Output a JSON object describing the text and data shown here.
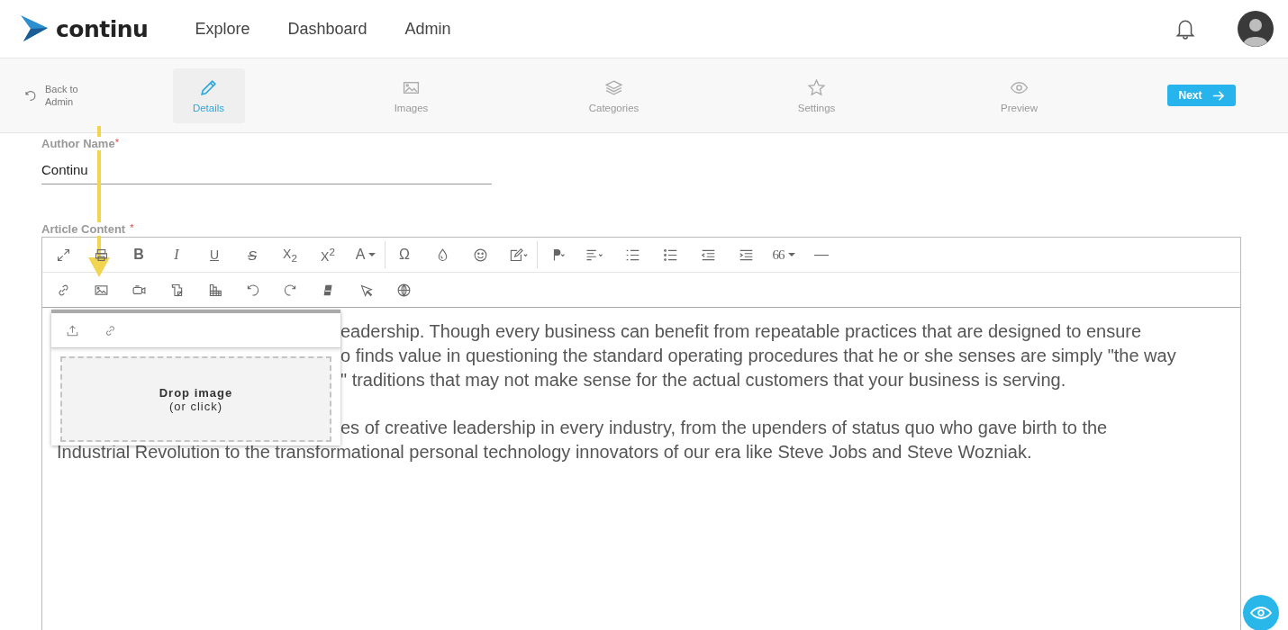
{
  "header": {
    "logo": "continu",
    "nav": [
      {
        "label": "Explore"
      },
      {
        "label": "Dashboard"
      },
      {
        "label": "Admin"
      }
    ]
  },
  "step_bar": {
    "back": "Back to Admin",
    "steps": [
      {
        "label": "Details",
        "kind": "pencil",
        "selected": true
      },
      {
        "label": "Images",
        "kind": "image",
        "selected": false
      },
      {
        "label": "Categories",
        "kind": "layers",
        "selected": false
      },
      {
        "label": "Settings",
        "kind": "star",
        "selected": false
      },
      {
        "label": "Preview",
        "kind": "eye",
        "selected": false
      }
    ],
    "next": "Next"
  },
  "author_field": {
    "label": "Author Name",
    "required_mark": "*",
    "value": "Continu"
  },
  "content_field": {
    "label": "Article Content",
    "required_mark": "*"
  },
  "toolbar": {
    "rows": [
      [
        {
          "kind": "expand"
        },
        {
          "kind": "print"
        },
        {
          "kind": "bold",
          "label": "B"
        },
        {
          "kind": "italic",
          "label": "I"
        },
        {
          "kind": "underline",
          "label": "U"
        },
        {
          "kind": "strike",
          "label": "S"
        },
        {
          "kind": "script",
          "label": "X$_{2}$"
        },
        {
          "kind": "script",
          "label": "X$^{2}$"
        },
        {
          "kind": "fontcolor",
          "label": "A"
        },
        {
          "kind": "sep"
        },
        {
          "kind": "plain",
          "label": "Ω"
        },
        {
          "kind": "drop"
        },
        {
          "kind": "smile"
        },
        {
          "kind": "edit"
        },
        {
          "kind": "sep"
        },
        {
          "kind": "paragraph"
        },
        {
          "kind": "align"
        },
        {
          "kind": "ol"
        },
        {
          "kind": "ul"
        },
        {
          "kind": "outdent"
        },
        {
          "kind": "indent"
        },
        {
          "kind": "quote",
          "label": "66"
        },
        {
          "kind": "plain",
          "label": "—"
        }
      ],
      [
        {
          "kind": "link"
        },
        {
          "kind": "image"
        },
        {
          "kind": "video"
        },
        {
          "kind": "file"
        },
        {
          "kind": "table"
        },
        {
          "kind": "undo"
        },
        {
          "kind": "redo"
        },
        {
          "kind": "eraser"
        },
        {
          "kind": "cursor"
        },
        {
          "kind": "globe"
        }
      ]
    ]
  },
  "image_popup": {
    "tabs": [
      {
        "kind": "upload"
      },
      {
        "kind": "link"
      }
    ],
    "drop_title": "Drop image",
    "drop_hint": "(or click)"
  },
  "paragraphs": [
    {
      "lines": [
        {
          "text": "eadership. Though every business can benefit from repeatable practices that are designed to ensure",
          "covered": true
        },
        {
          "text": "o finds value in questioning the standard operating procedures that he or she senses are simply \"the way",
          "covered": true
        },
        {
          "text": "\" traditions that may not make sense for the actual customers that your business is serving.",
          "covered": true
        }
      ]
    },
    {
      "lines": [
        {
          "text": "es of creative leadership in every industry, from the upenders of status quo who gave birth to the",
          "covered": true
        },
        {
          "text": "Industrial Revolution to the transformational personal technology innovators of our era like Steve Jobs and Steve Wozniak.",
          "covered": false
        }
      ]
    }
  ]
}
